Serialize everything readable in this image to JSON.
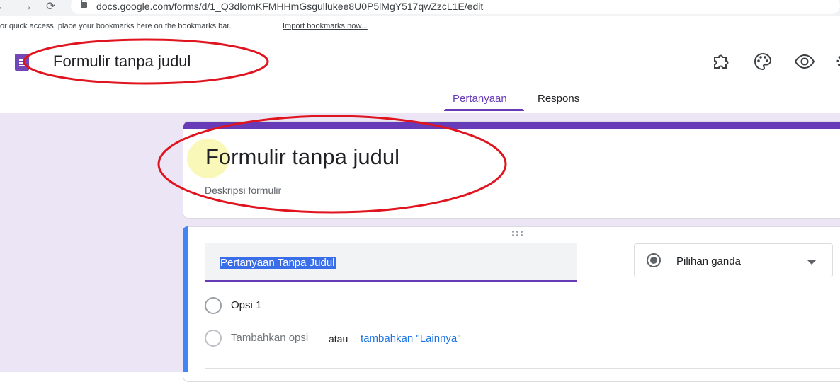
{
  "browser": {
    "back_glyph": "←",
    "forward_glyph": "→",
    "reload_glyph": "⟳",
    "url": "docs.google.com/forms/d/1_Q3dlomKFMHHmGsgullukee8U0P5lMgY517qwZzcL1E/edit",
    "bookmarks_hint": "or quick access, place your bookmarks here on the bookmarks bar.",
    "import_bookmarks": "Import bookmarks now..."
  },
  "header": {
    "doc_title": "Formulir tanpa judul",
    "icons": [
      "puzzle-icon",
      "palette-icon",
      "eye-icon",
      "settings-icon"
    ],
    "tabs": [
      {
        "label": "Pertanyaan",
        "active": true
      },
      {
        "label": "Respons",
        "active": false
      }
    ]
  },
  "form": {
    "title": "Formulir tanpa judul",
    "description": "Deskripsi formulir",
    "accent_color": "#673ab7",
    "background_color": "#ebe5f5"
  },
  "question": {
    "title": "Pertanyaan Tanpa Judul",
    "type": "Pilihan ganda",
    "options": [
      "Opsi 1"
    ],
    "add_option": "Tambahkan opsi",
    "or": "atau",
    "add_other": "tambahkan \"Lainnya\"",
    "active_color": "#4285f4"
  },
  "annotations": {
    "color": "#e0141e",
    "shape": "ellipse"
  }
}
